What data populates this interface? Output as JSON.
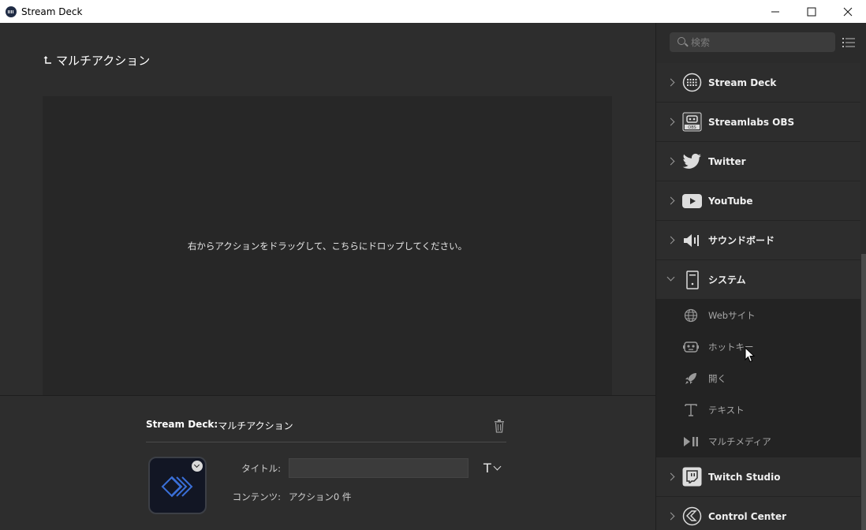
{
  "window": {
    "title": "Stream Deck",
    "minimize_icon": "minimize-icon",
    "maximize_icon": "maximize-icon",
    "close_icon": "close-icon"
  },
  "main": {
    "back_title": "マルチアクション",
    "drop_hint": "右からアクションをドラッグして、こちらにドロップしてください。"
  },
  "inspector": {
    "plugin_name": "Stream Deck",
    "separator": ":",
    "action_name": "マルチアクション",
    "title_label": "タイトル:",
    "title_value": "",
    "content_label": "コンテンツ:",
    "content_value": "アクション0 件",
    "title_format_glyph": "T"
  },
  "sidebar": {
    "search_placeholder": "検索",
    "categories": [
      {
        "label": "Stream Deck",
        "icon": "stream-deck-icon",
        "expanded": false
      },
      {
        "label": "Streamlabs OBS",
        "icon": "streamlabs-obs-icon",
        "expanded": false
      },
      {
        "label": "Twitter",
        "icon": "twitter-icon",
        "expanded": false
      },
      {
        "label": "YouTube",
        "icon": "youtube-icon",
        "expanded": false
      },
      {
        "label": "サウンドボード",
        "icon": "speaker-icon",
        "expanded": false
      },
      {
        "label": "システム",
        "icon": "computer-icon",
        "expanded": true
      },
      {
        "label": "Twitch Studio",
        "icon": "twitch-studio-icon",
        "expanded": false
      },
      {
        "label": "Control Center",
        "icon": "control-center-icon",
        "expanded": false
      }
    ],
    "system_actions": [
      {
        "label": "Webサイト",
        "icon": "globe-icon"
      },
      {
        "label": "ホットキー",
        "icon": "hotkey-robot-icon"
      },
      {
        "label": "開く",
        "icon": "rocket-icon"
      },
      {
        "label": "テキスト",
        "icon": "text-icon"
      },
      {
        "label": "マルチメディア",
        "icon": "play-pause-icon"
      }
    ]
  },
  "colors": {
    "accent": "#3a6fd8",
    "background": "#2d2d2d",
    "panel": "#232323"
  }
}
